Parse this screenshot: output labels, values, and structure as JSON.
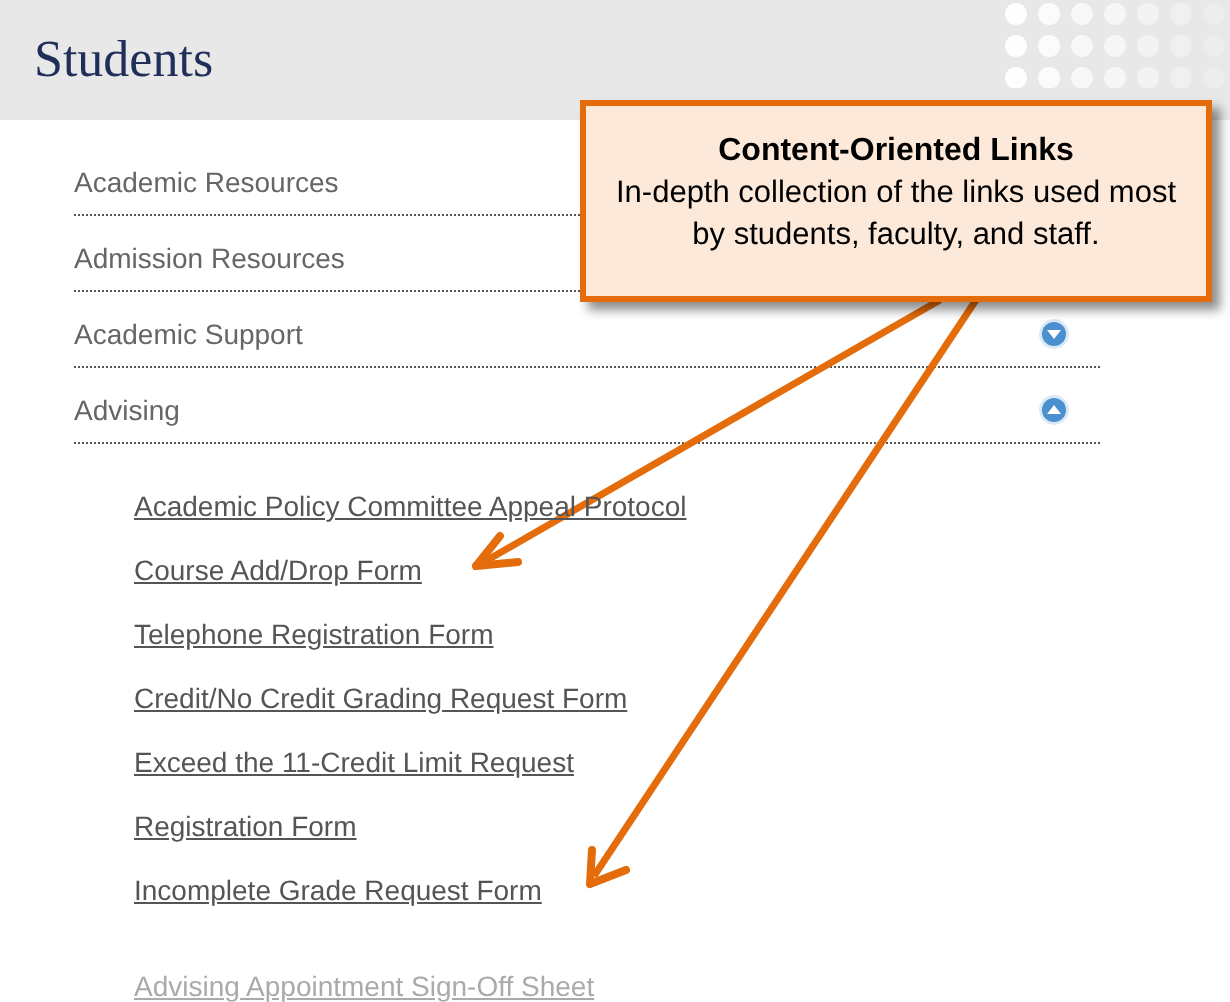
{
  "header": {
    "title": "Students"
  },
  "sections": [
    {
      "label": "Academic Resources"
    },
    {
      "label": "Admission Resources"
    },
    {
      "label": "Academic Support",
      "expanded": false
    },
    {
      "label": "Advising",
      "expanded": true
    }
  ],
  "links": [
    {
      "label": "Academic Policy Committee Appeal Protocol",
      "faded": false
    },
    {
      "label": "Course Add/Drop Form",
      "faded": false
    },
    {
      "label": "Telephone Registration Form",
      "faded": false
    },
    {
      "label": "Credit/No Credit Grading Request Form",
      "faded": false
    },
    {
      "label": "Exceed the 11-Credit Limit Request",
      "faded": false
    },
    {
      "label": "Registration Form",
      "faded": false
    },
    {
      "label": "Incomplete Grade Request Form",
      "faded": false
    },
    {
      "label": "Advising Appointment Sign-Off Sheet",
      "faded": true
    }
  ],
  "callout": {
    "title": "Content-Oriented Links",
    "text": "In-depth collection of the links used most by students, faculty, and staff."
  }
}
